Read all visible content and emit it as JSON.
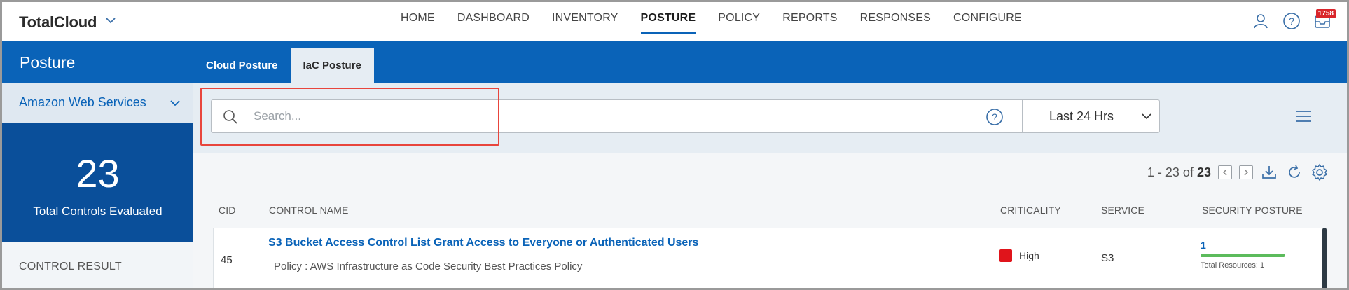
{
  "app": {
    "brand": "TotalCloud"
  },
  "nav": {
    "items": [
      {
        "label": "HOME"
      },
      {
        "label": "DASHBOARD"
      },
      {
        "label": "INVENTORY"
      },
      {
        "label": "POSTURE"
      },
      {
        "label": "POLICY"
      },
      {
        "label": "REPORTS"
      },
      {
        "label": "RESPONSES"
      },
      {
        "label": "CONFIGURE"
      }
    ],
    "active": "POSTURE",
    "notification_count": "1758"
  },
  "header": {
    "title": "Posture",
    "tabs": [
      {
        "label": "Cloud Posture",
        "active": false
      },
      {
        "label": "IaC Posture",
        "active": true
      }
    ]
  },
  "sidebar": {
    "account": "Amazon Web Services",
    "stat_value": "23",
    "stat_label": "Total Controls Evaluated",
    "section_label": "CONTROL RESULT"
  },
  "search": {
    "placeholder": "Search...",
    "value": ""
  },
  "time_range": {
    "selected": "Last 24 Hrs"
  },
  "pager": {
    "range": "1 - 23 of",
    "total": "23"
  },
  "table": {
    "columns": [
      "CID",
      "CONTROL NAME",
      "CRITICALITY",
      "SERVICE",
      "SECURITY POSTURE"
    ],
    "rows": [
      {
        "cid": "45",
        "name": "S3 Bucket Access Control List Grant Access to Everyone or Authenticated Users",
        "policy": "Policy : AWS Infrastructure as Code Security Best Practices Policy",
        "criticality": "High",
        "service": "S3",
        "posture_value": "1",
        "posture_sub": "Total Resources: 1"
      }
    ]
  },
  "colors": {
    "primary": "#0a63b8",
    "dark_blue": "#0a4f9a",
    "critical_high": "#e0141b",
    "pass_green": "#5cbb5c",
    "highlight_red": "#e8453c"
  },
  "icons": [
    "chevron-down-icon",
    "user-icon",
    "help-icon",
    "notifications-icon",
    "search-icon",
    "hamburger-menu-icon",
    "prev-page-icon",
    "next-page-icon",
    "download-icon",
    "refresh-icon",
    "settings-icon"
  ]
}
